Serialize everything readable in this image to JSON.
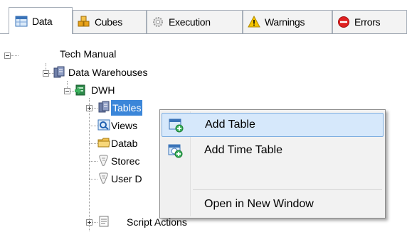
{
  "tabs": [
    {
      "label": "Data",
      "icon": "data-grid-icon",
      "active": true
    },
    {
      "label": "Cubes",
      "icon": "cubes-icon",
      "active": false
    },
    {
      "label": "Execution",
      "icon": "execution-gear-icon",
      "active": false
    },
    {
      "label": "Warnings",
      "icon": "warning-triangle-icon",
      "active": false
    },
    {
      "label": "Errors",
      "icon": "error-circle-icon",
      "active": false
    }
  ],
  "tree": {
    "root": "Tech Manual",
    "data_warehouses": "Data Warehouses",
    "dwh": "DWH",
    "tables": "Tables",
    "views": "Views",
    "databases": "Datab",
    "stored": "Storec",
    "user_defined": "User D",
    "script_actions": "Script Actions"
  },
  "context_menu": {
    "items": [
      {
        "label": "Add Table",
        "icon": "add-table-icon"
      },
      {
        "label": "Add Time Table",
        "icon": "add-time-table-icon"
      },
      {
        "label": "Open in New Window",
        "icon": ""
      }
    ]
  },
  "colors": {
    "selection": "#3b86d9",
    "menu_hover": "#d6e8fb",
    "warning": "#f5c400",
    "error": "#e02020"
  }
}
